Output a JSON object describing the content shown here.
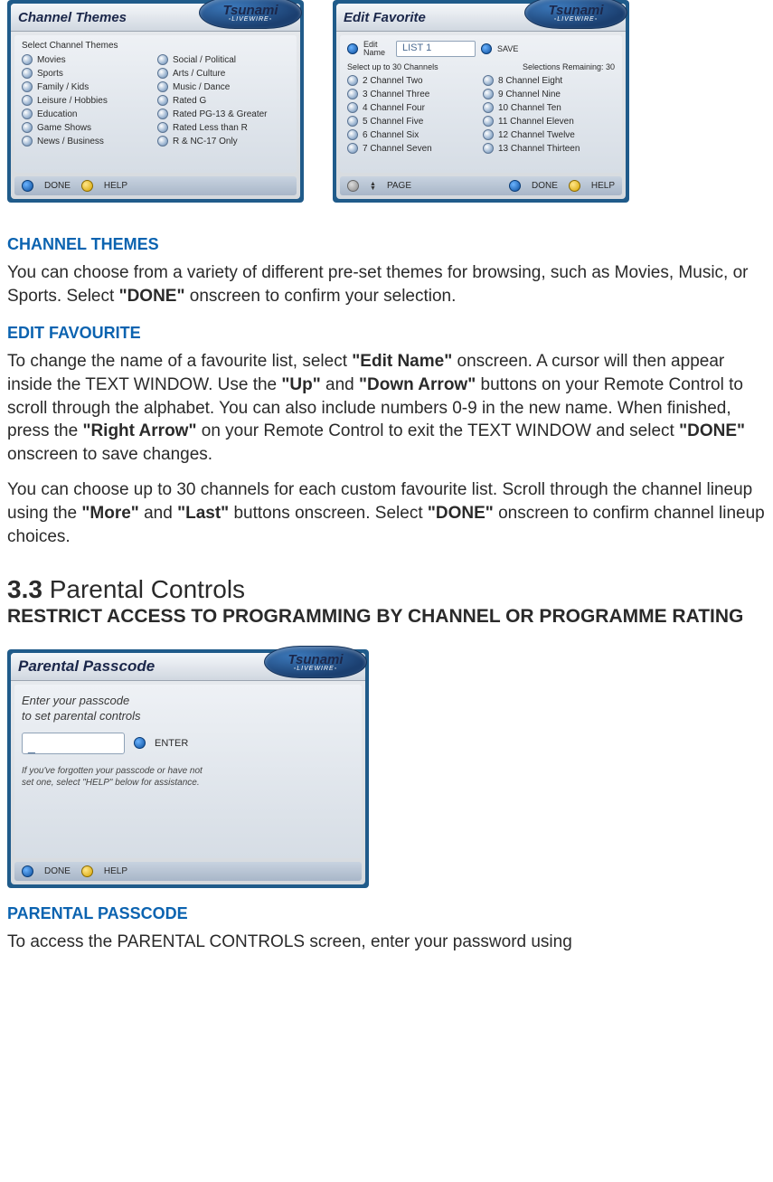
{
  "brand": {
    "name": "Tsunami",
    "sub": "◦LIVEWIRE◦"
  },
  "panels": {
    "themes": {
      "title": "Channel Themes",
      "subtitle": "Select Channel Themes",
      "left": [
        "Movies",
        "Sports",
        "Family / Kids",
        "Leisure / Hobbies",
        "Education",
        "Game Shows",
        "News / Business"
      ],
      "right": [
        "Social / Political",
        "Arts / Culture",
        "Music / Dance",
        "Rated G",
        "Rated PG-13 & Greater",
        "Rated Less than R",
        "R & NC-17 Only"
      ],
      "footer": {
        "done": "DONE",
        "help": "HELP"
      }
    },
    "favorite": {
      "title": "Edit Favorite",
      "editNameLabel": "Edit\nName",
      "textValue": "LIST 1",
      "save": "SAVE",
      "selHeaderLeft": "Select up to 30 Channels",
      "selHeaderRight": "Selections Remaining: 30",
      "left": [
        "2 Channel Two",
        "3 Channel Three",
        "4 Channel Four",
        "5 Channel Five",
        "6 Channel Six",
        "7 Channel Seven"
      ],
      "right": [
        "8 Channel Eight",
        "9 Channel Nine",
        "10 Channel Ten",
        "11 Channel Eleven",
        "12 Channel Twelve",
        "13 Channel Thirteen"
      ],
      "footer": {
        "page": "PAGE",
        "done": "DONE",
        "help": "HELP"
      }
    },
    "passcode": {
      "title": "Parental Passcode",
      "prompt1": "Enter your passcode",
      "prompt2": "to set parental controls",
      "inputValue": "_",
      "enter": "ENTER",
      "forgot1": "If you've forgotten your passcode or have not",
      "forgot2": "set one, select \"HELP\" below for assistance.",
      "footer": {
        "done": "DONE",
        "help": "HELP"
      }
    }
  },
  "doc": {
    "h_channelThemes": "CHANNEL THEMES",
    "p_channelThemes_a": "You can choose from a variety of different pre-set themes for browsing, such as Movies, Music, or Sports. Select ",
    "p_channelThemes_b": "\"DONE\"",
    "p_channelThemes_c": " onscreen to confirm your selection.",
    "h_editFav": "EDIT FAVOURITE",
    "p_editFav1_a": "To change the name of a favourite list, select ",
    "p_editFav1_b": "\"Edit Name\"",
    "p_editFav1_c": " onscreen. A cursor will then appear inside the TEXT WINDOW. Use the ",
    "p_editFav1_d": "\"Up\"",
    "p_editFav1_e": " and ",
    "p_editFav1_f": "\"Down Arrow\"",
    "p_editFav1_g": " buttons on your Remote Control to scroll through the alphabet. You can also include numbers 0-9 in the new name. When finished, press the ",
    "p_editFav1_h": "\"Right Arrow\"",
    "p_editFav1_i": " on your Remote Control to exit the TEXT WINDOW and select ",
    "p_editFav1_j": "\"DONE\"",
    "p_editFav1_k": " onscreen to save changes.",
    "p_editFav2_a": "You can choose up to 30 channels for each custom favourite list. Scroll through the channel lineup using the ",
    "p_editFav2_b": "\"More\"",
    "p_editFav2_c": " and ",
    "p_editFav2_d": "\"Last\"",
    "p_editFav2_e": " buttons onscreen. Select ",
    "p_editFav2_f": "\"DONE\"",
    "p_editFav2_g": " onscreen to confirm channel lineup choices.",
    "h_section_num": "3.3",
    "h_section_title": " Parental Controls",
    "h_section_sub": "RESTRICT ACCESS TO PROGRAMMING BY CHANNEL OR PROGRAMME RATING",
    "h_parentalPasscode": "PARENTAL PASSCODE",
    "p_parentalPasscode": "To access the PARENTAL CONTROLS screen, enter your password using"
  }
}
